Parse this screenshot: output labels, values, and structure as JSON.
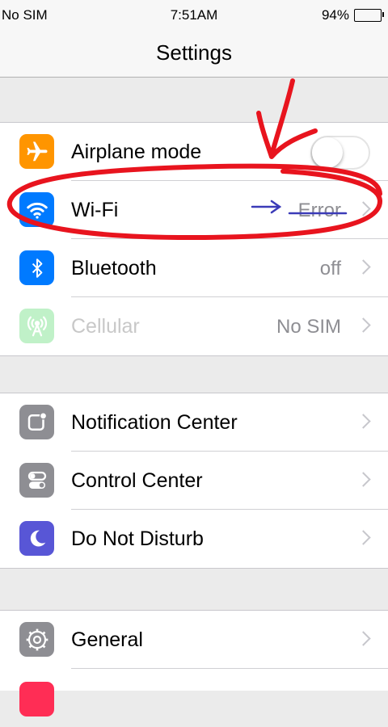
{
  "status_bar": {
    "carrier": "No SIM",
    "time": "7:51AM",
    "battery": "94%",
    "battery_level": 0.94
  },
  "nav": {
    "title": "Settings"
  },
  "groups": [
    {
      "rows": [
        {
          "label": "Airplane mode",
          "icon": "airplane-icon",
          "color": "#ff9500",
          "control": "toggle",
          "toggle_on": false
        },
        {
          "label": "Wi-Fi",
          "icon": "wifi-icon",
          "color": "#007aff",
          "value": "Error"
        },
        {
          "label": "Bluetooth",
          "icon": "bluetooth-icon",
          "color": "#007aff",
          "value": "off"
        },
        {
          "label": "Cellular",
          "icon": "cellular-icon",
          "color": "#4cd964",
          "value": "No SIM",
          "disabled": true
        }
      ]
    },
    {
      "rows": [
        {
          "label": "Notification Center",
          "icon": "notification-center-icon",
          "color": "#8e8e93"
        },
        {
          "label": "Control Center",
          "icon": "control-center-icon",
          "color": "#8e8e93"
        },
        {
          "label": "Do Not Disturb",
          "icon": "moon-icon",
          "color": "#5856d6"
        }
      ]
    },
    {
      "rows": [
        {
          "label": "General",
          "icon": "gear-icon",
          "color": "#8e8e93"
        }
      ]
    }
  ],
  "annotations": {
    "circle_color": "#e8141e",
    "arrow_color": "#3b3bb8"
  }
}
